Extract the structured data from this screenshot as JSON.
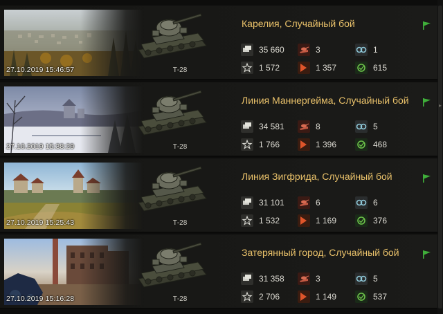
{
  "battles": [
    {
      "map": "Карелия, Случайный бой",
      "date": "27.10.2019 15:46:57",
      "tank": "Т-28",
      "credits": "35 660",
      "kills": "3",
      "spotted": "1",
      "xp": "1 572",
      "damage": "1 357",
      "assist": "615",
      "scene": "autumn-village"
    },
    {
      "map": "Линия Маннергейма, Случайный бой",
      "date": "27.10.2019 15:38:29",
      "tank": "Т-28",
      "credits": "34 581",
      "kills": "8",
      "spotted": "5",
      "xp": "1 766",
      "damage": "1 396",
      "assist": "468",
      "scene": "snow-castle"
    },
    {
      "map": "Линия Зигфрида, Случайный бой",
      "date": "27.10.2019 15:25:43",
      "tank": "Т-28",
      "credits": "31 101",
      "kills": "6",
      "spotted": "6",
      "xp": "1 532",
      "damage": "1 169",
      "assist": "376",
      "scene": "green-town"
    },
    {
      "map": "Затерянный город, Случайный бой",
      "date": "27.10.2019 15:16:28",
      "tank": "Т-28",
      "credits": "31 358",
      "kills": "3",
      "spotted": "5",
      "xp": "2 706",
      "damage": "1 149",
      "assist": "537",
      "scene": "ruined-city"
    }
  ],
  "colors": {
    "title": "#e9c16a",
    "flag": "#3fae3a",
    "damage": "#e0552a",
    "kills": "#b84a3a",
    "assist": "#6cc24a",
    "spotted": "#8fc9d9"
  }
}
